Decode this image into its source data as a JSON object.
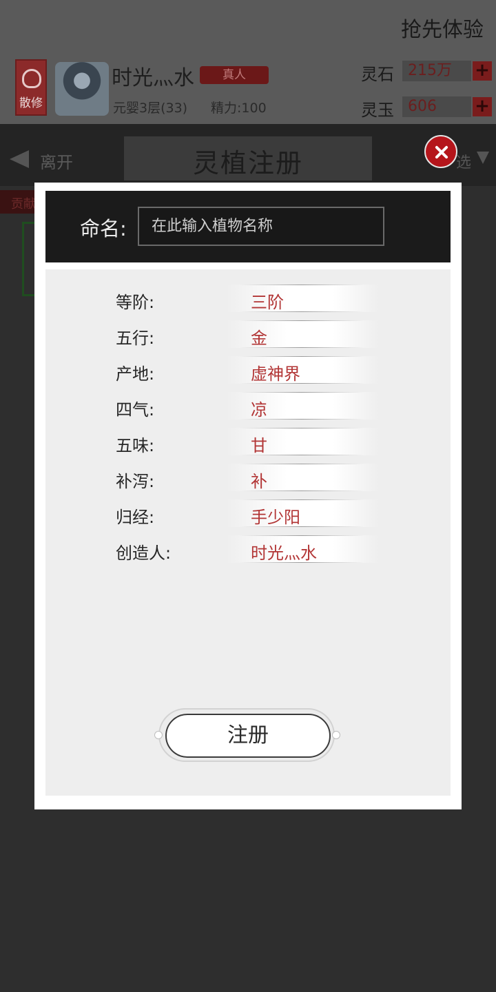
{
  "header": {
    "early_access": "抢先体验",
    "sect_badge": "散修",
    "player_name": "时光灬水",
    "rank_tag": "真人",
    "realm": "元婴3层(33)",
    "energy": "精力:100",
    "currencies": [
      {
        "label": "灵石",
        "value": "215万"
      },
      {
        "label": "灵玉",
        "value": "606"
      }
    ]
  },
  "nav": {
    "leave": "离开",
    "title": "灵植注册",
    "filter": "选",
    "side_tab": "贡献"
  },
  "modal": {
    "name_label": "命名:",
    "name_placeholder": "在此输入植物名称",
    "properties": [
      {
        "label": "等阶:",
        "value": "三阶"
      },
      {
        "label": "五行:",
        "value": "金"
      },
      {
        "label": "产地:",
        "value": "虚神界"
      },
      {
        "label": "四气:",
        "value": "凉"
      },
      {
        "label": "五味:",
        "value": "甘"
      },
      {
        "label": "补泻:",
        "value": "补"
      },
      {
        "label": "归经:",
        "value": "手少阳"
      },
      {
        "label": "创造人:",
        "value": "时光灬水"
      }
    ],
    "register_label": "注册"
  },
  "colors": {
    "accent_red": "#b23535",
    "close_red": "#b5151b"
  }
}
